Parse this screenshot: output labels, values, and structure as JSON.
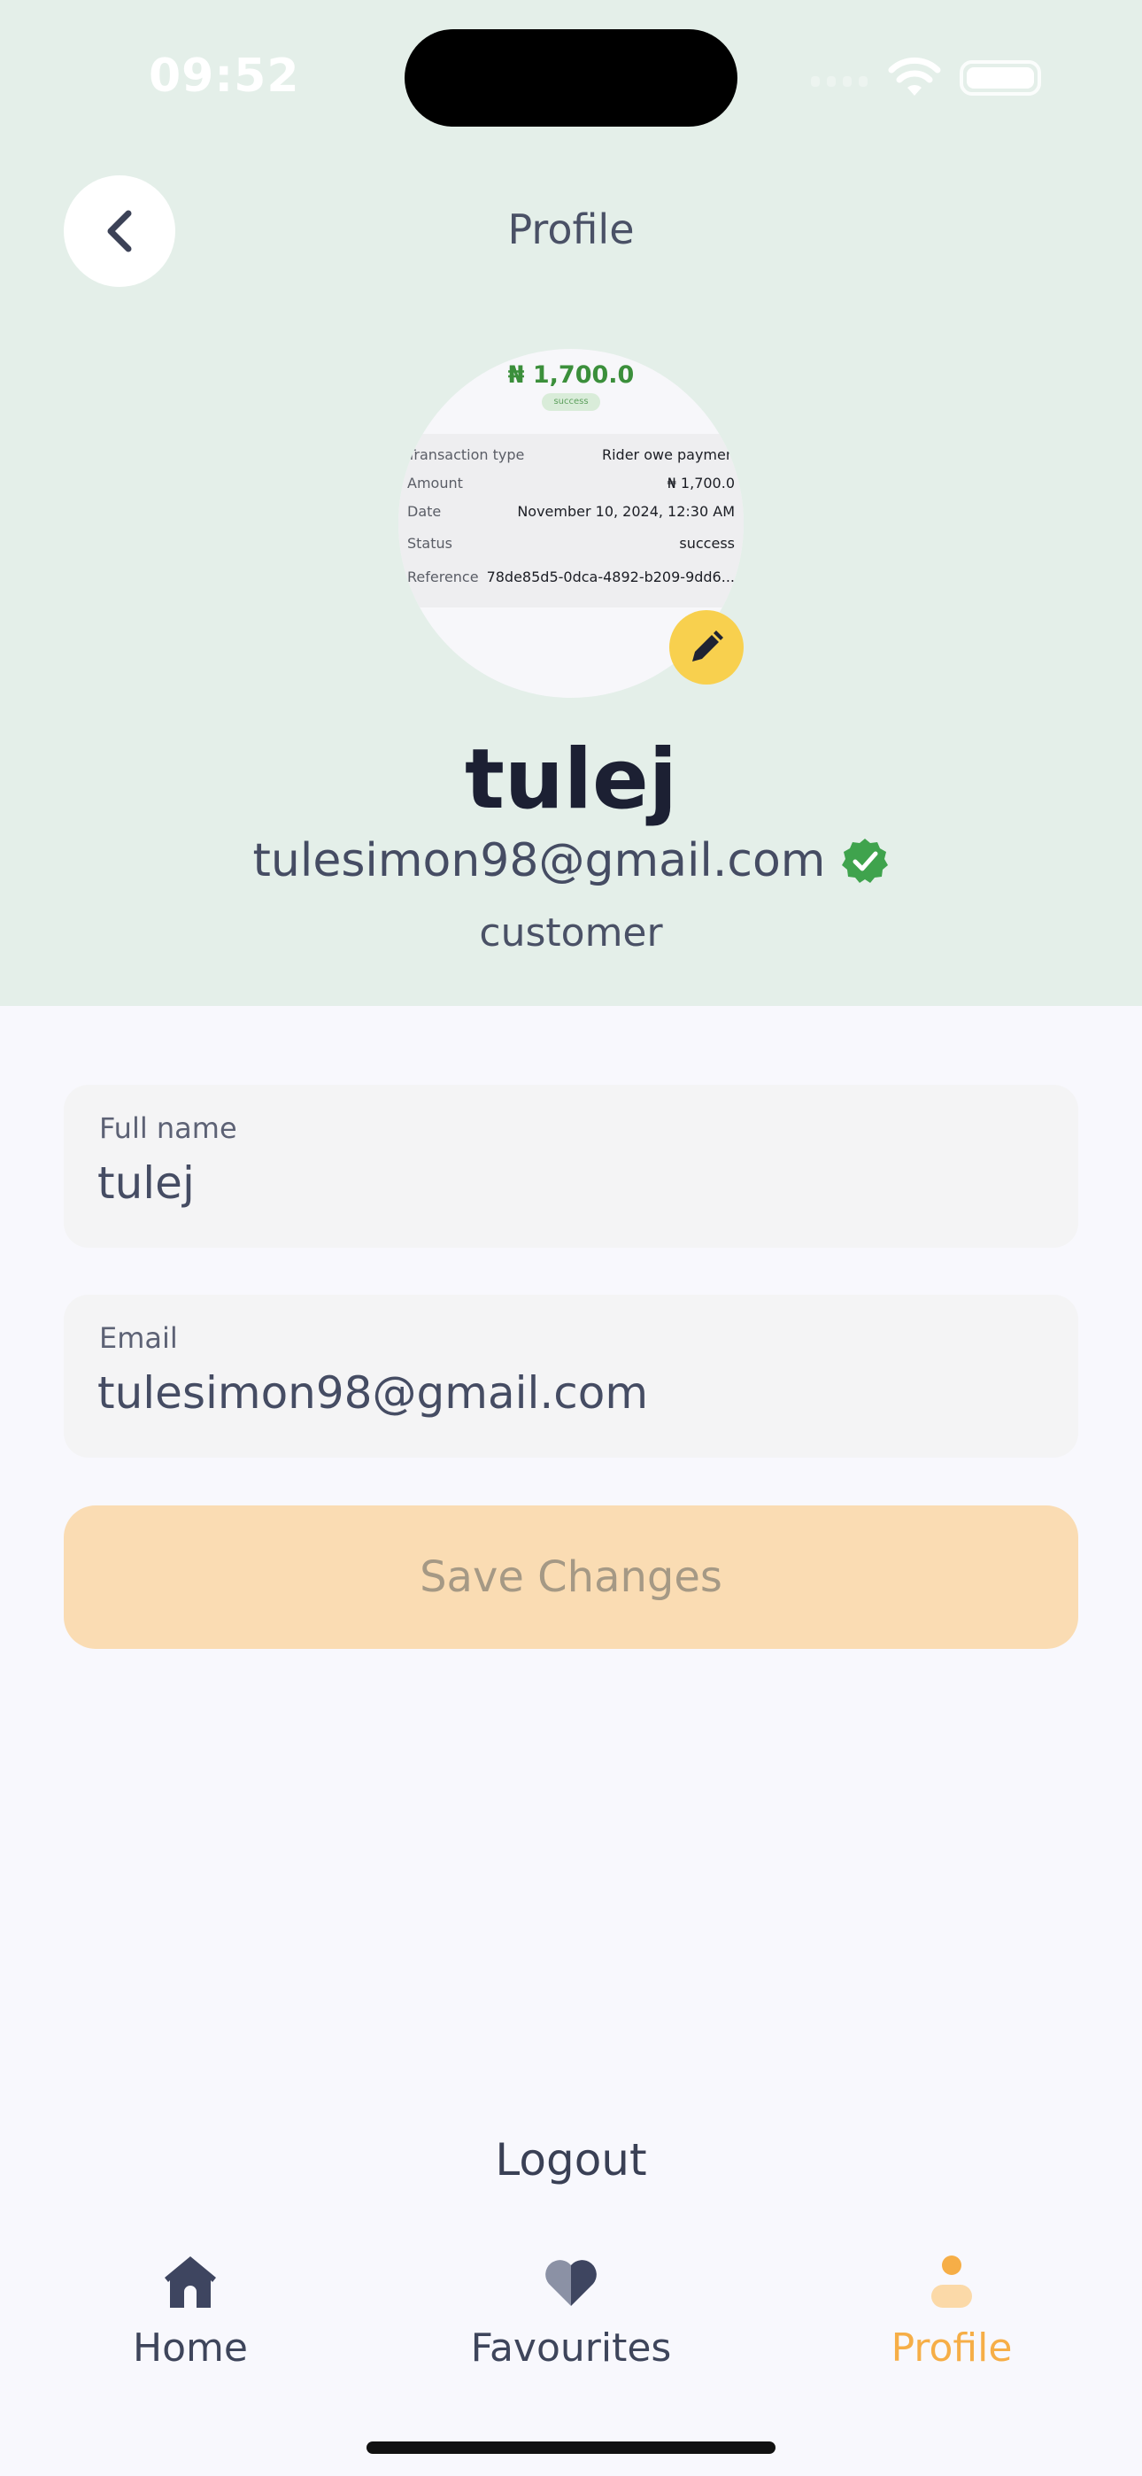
{
  "status_bar": {
    "time": "09:52"
  },
  "header": {
    "title": "Profile",
    "back_icon": "chevron-left-icon"
  },
  "avatar_receipt": {
    "amount": "₦ 1,700.0",
    "status_badge": "success",
    "rows": [
      {
        "key": "Transaction type",
        "value": "Rider owe paymen"
      },
      {
        "key": "Amount",
        "value": "₦ 1,700.0"
      },
      {
        "key": "Date",
        "value": "November 10, 2024, 12:30 AM"
      },
      {
        "key": "Status",
        "value": "success"
      },
      {
        "key": "Reference",
        "value": "78de85d5-0dca-4892-b209-9dd6..."
      }
    ]
  },
  "profile": {
    "name": "tulej",
    "email": "tulesimon98@gmail.com",
    "role": "customer",
    "verified": true
  },
  "form": {
    "full_name": {
      "label": "Full name",
      "value": "tulej"
    },
    "email": {
      "label": "Email",
      "value": "tulesimon98@gmail.com"
    },
    "save_label": "Save Changes"
  },
  "logout_label": "Logout",
  "nav": {
    "items": [
      {
        "label": "Home",
        "icon": "home-icon",
        "active": false
      },
      {
        "label": "Favourites",
        "icon": "heart-icon",
        "active": false
      },
      {
        "label": "Profile",
        "icon": "person-icon",
        "active": true
      }
    ]
  },
  "colors": {
    "header_bg": "#e4efe9",
    "accent": "#f6ae47",
    "save_button_bg": "#fadcb3",
    "verified_green": "#3fa34d",
    "edit_badge": "#f8d04e"
  }
}
